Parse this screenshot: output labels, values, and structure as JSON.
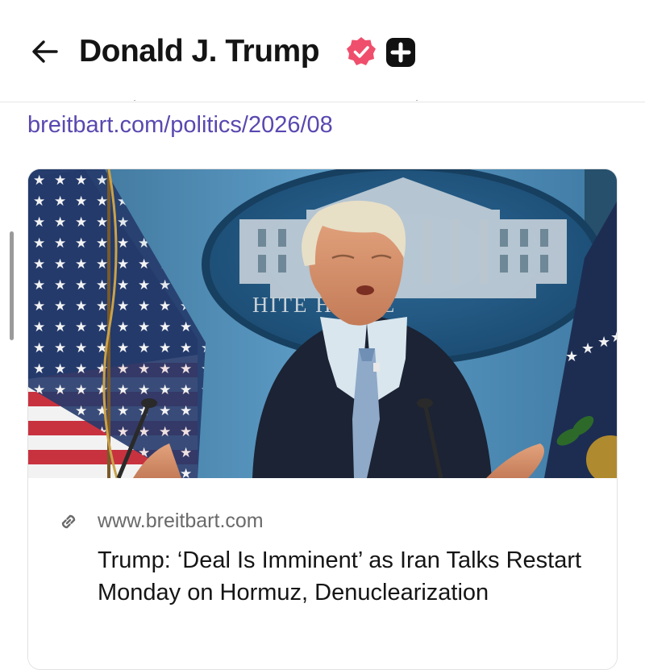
{
  "header": {
    "title": "Donald J. Trump",
    "back_icon": "arrow-left-icon",
    "verified_icon": "verified-badge-icon",
    "platform_icon": "plus-square-icon"
  },
  "post": {
    "link_text": "breitbart.com/politics/2026/08"
  },
  "link_card": {
    "image_alt": "Donald Trump speaking at a podium in the White House press briefing room",
    "image_text": "HITE HOUSE",
    "link_icon": "link-icon",
    "domain": "www.breitbart.com",
    "title": "Trump: ‘Deal Is Imminent’ as Iran Talks Restart Monday on Hormuz, Denuclearization"
  },
  "colors": {
    "link": "#5a48b0",
    "verified_badge": "#ef4f6c",
    "platform_badge": "#111111",
    "briefing_blue": "#2f6fa0"
  }
}
